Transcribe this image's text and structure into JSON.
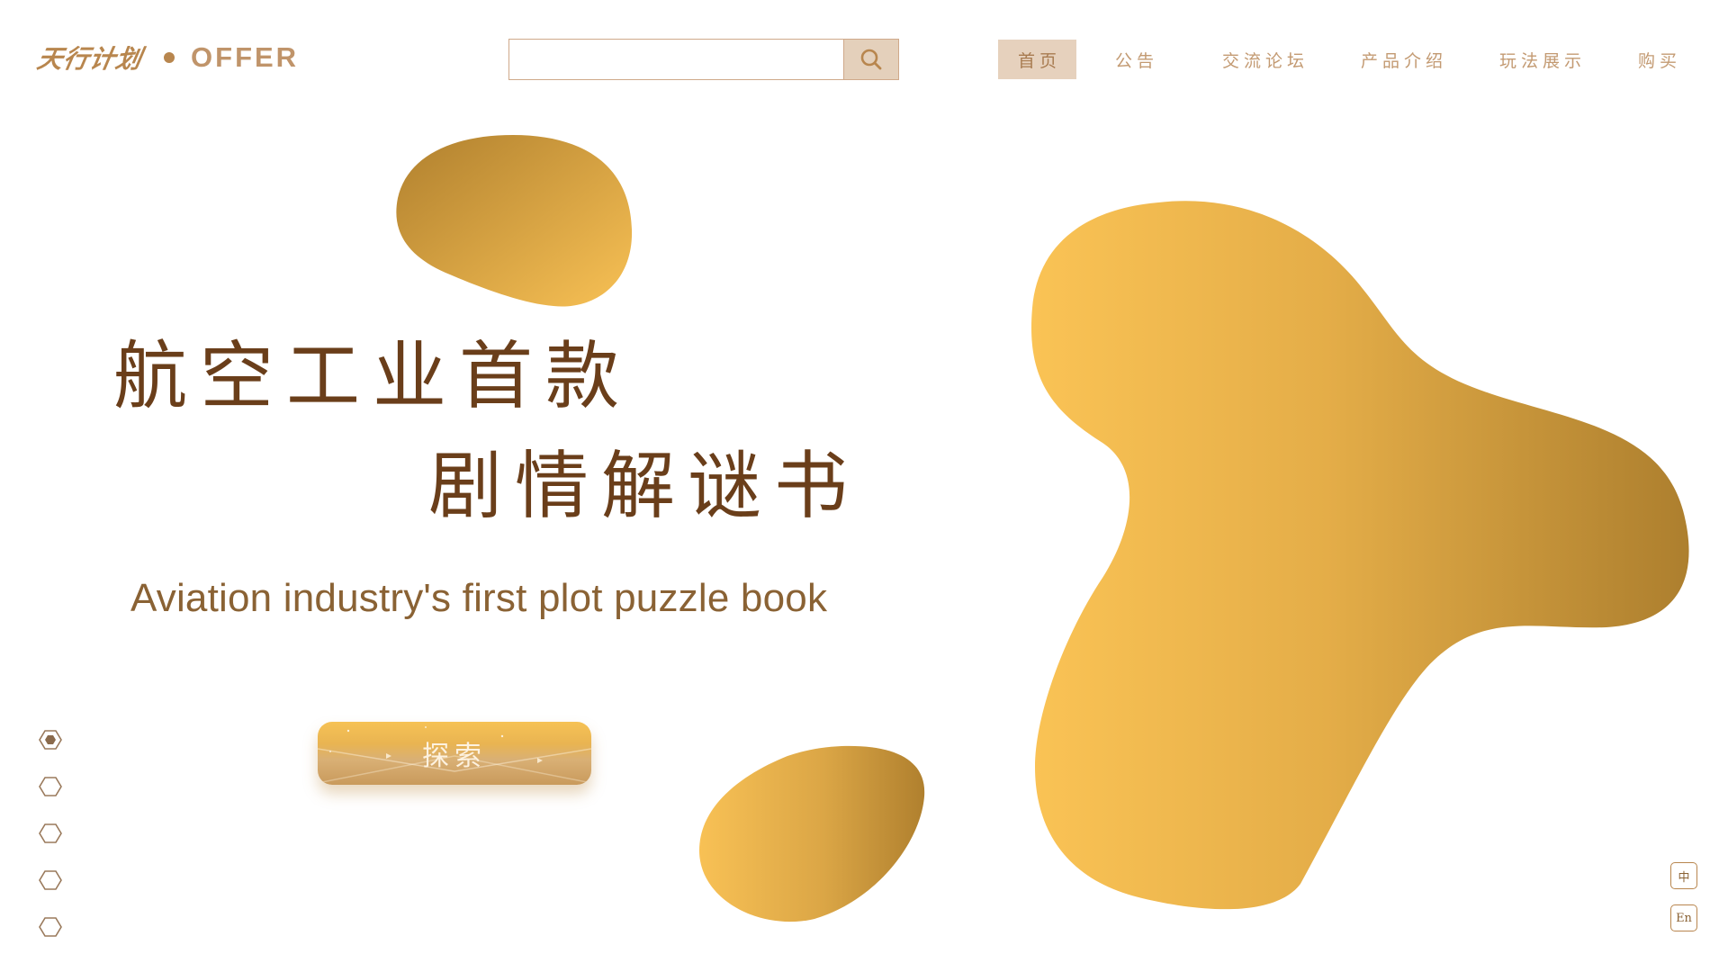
{
  "header": {
    "logo_cn": "天行计划",
    "logo_en": "OFFER",
    "search": {
      "value": "",
      "placeholder": ""
    }
  },
  "nav": {
    "items": [
      {
        "label": "首页",
        "active": true
      },
      {
        "label": "公告",
        "active": false
      },
      {
        "label": "交流论坛",
        "active": false
      },
      {
        "label": "产品介绍",
        "active": false
      },
      {
        "label": "玩法展示",
        "active": false
      },
      {
        "label": "购买",
        "active": false
      }
    ]
  },
  "hero": {
    "line1": "航空工业首款",
    "line2": "剧情解谜书",
    "subtitle": "Aviation industry's first plot puzzle book",
    "button_label": "探索"
  },
  "side_nav": {
    "count": 5,
    "active_index": 0
  },
  "language": {
    "zh": "中",
    "en": "En"
  },
  "colors": {
    "brand": "#b8864e",
    "title": "#6a3e1a",
    "subtitle": "#8a6234",
    "nav_text": "#c39a72",
    "nav_active_bg": "#e6d1bd",
    "gold_light": "#f8c155",
    "gold_dark": "#b0802e"
  },
  "icons": {
    "search": "search-icon",
    "side_dot": "hexagon-icon"
  }
}
